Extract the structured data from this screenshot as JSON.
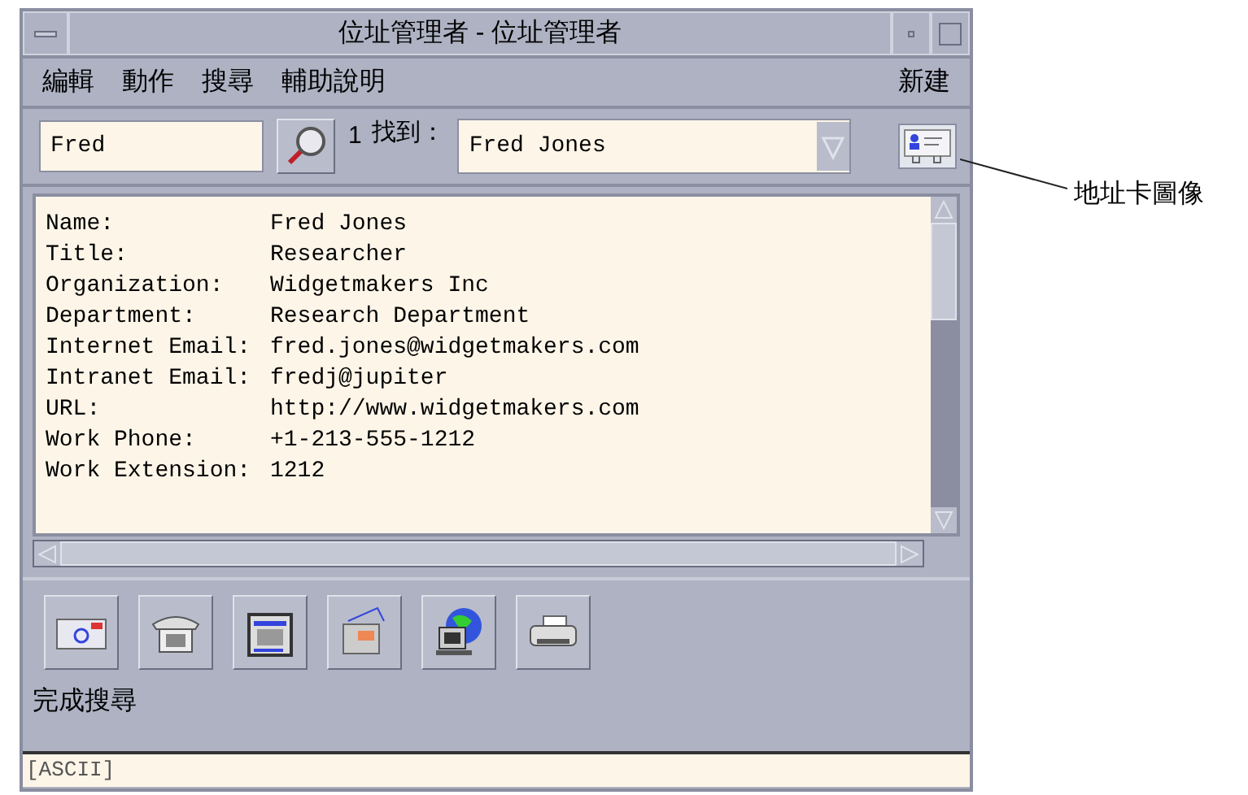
{
  "window": {
    "title": "位址管理者 - 位址管理者"
  },
  "menu": [
    {
      "label": "編輯"
    },
    {
      "label": "動作"
    },
    {
      "label": "搜尋"
    },
    {
      "label": "輔助說明"
    }
  ],
  "menu_right": {
    "label": "新建"
  },
  "search": {
    "value": "Fred"
  },
  "found": {
    "count": "1",
    "label": "找到："
  },
  "results": {
    "value": "Fred Jones"
  },
  "record": [
    {
      "label": "Name:",
      "value": "Fred Jones"
    },
    {
      "label": "Title:",
      "value": "Researcher"
    },
    {
      "label": "Organization:",
      "value": "Widgetmakers Inc"
    },
    {
      "label": "Department:",
      "value": "Research Department"
    },
    {
      "label": "Internet Email:",
      "value": "fred.jones@widgetmakers.com"
    },
    {
      "label": "Intranet Email:",
      "value": "fredj@jupiter"
    },
    {
      "label": "URL:",
      "value": "http://www.widgetmakers.com"
    },
    {
      "label": "Work Phone:",
      "value": "+1-213-555-1212"
    },
    {
      "label": "Work Extension:",
      "value": "1212"
    }
  ],
  "actions": [
    {
      "kind": "mail"
    },
    {
      "kind": "phone"
    },
    {
      "kind": "calendar"
    },
    {
      "kind": "card"
    },
    {
      "kind": "web"
    },
    {
      "kind": "print"
    }
  ],
  "status": "完成搜尋",
  "input_method": "[ASCII]",
  "callout": "地址卡圖像"
}
